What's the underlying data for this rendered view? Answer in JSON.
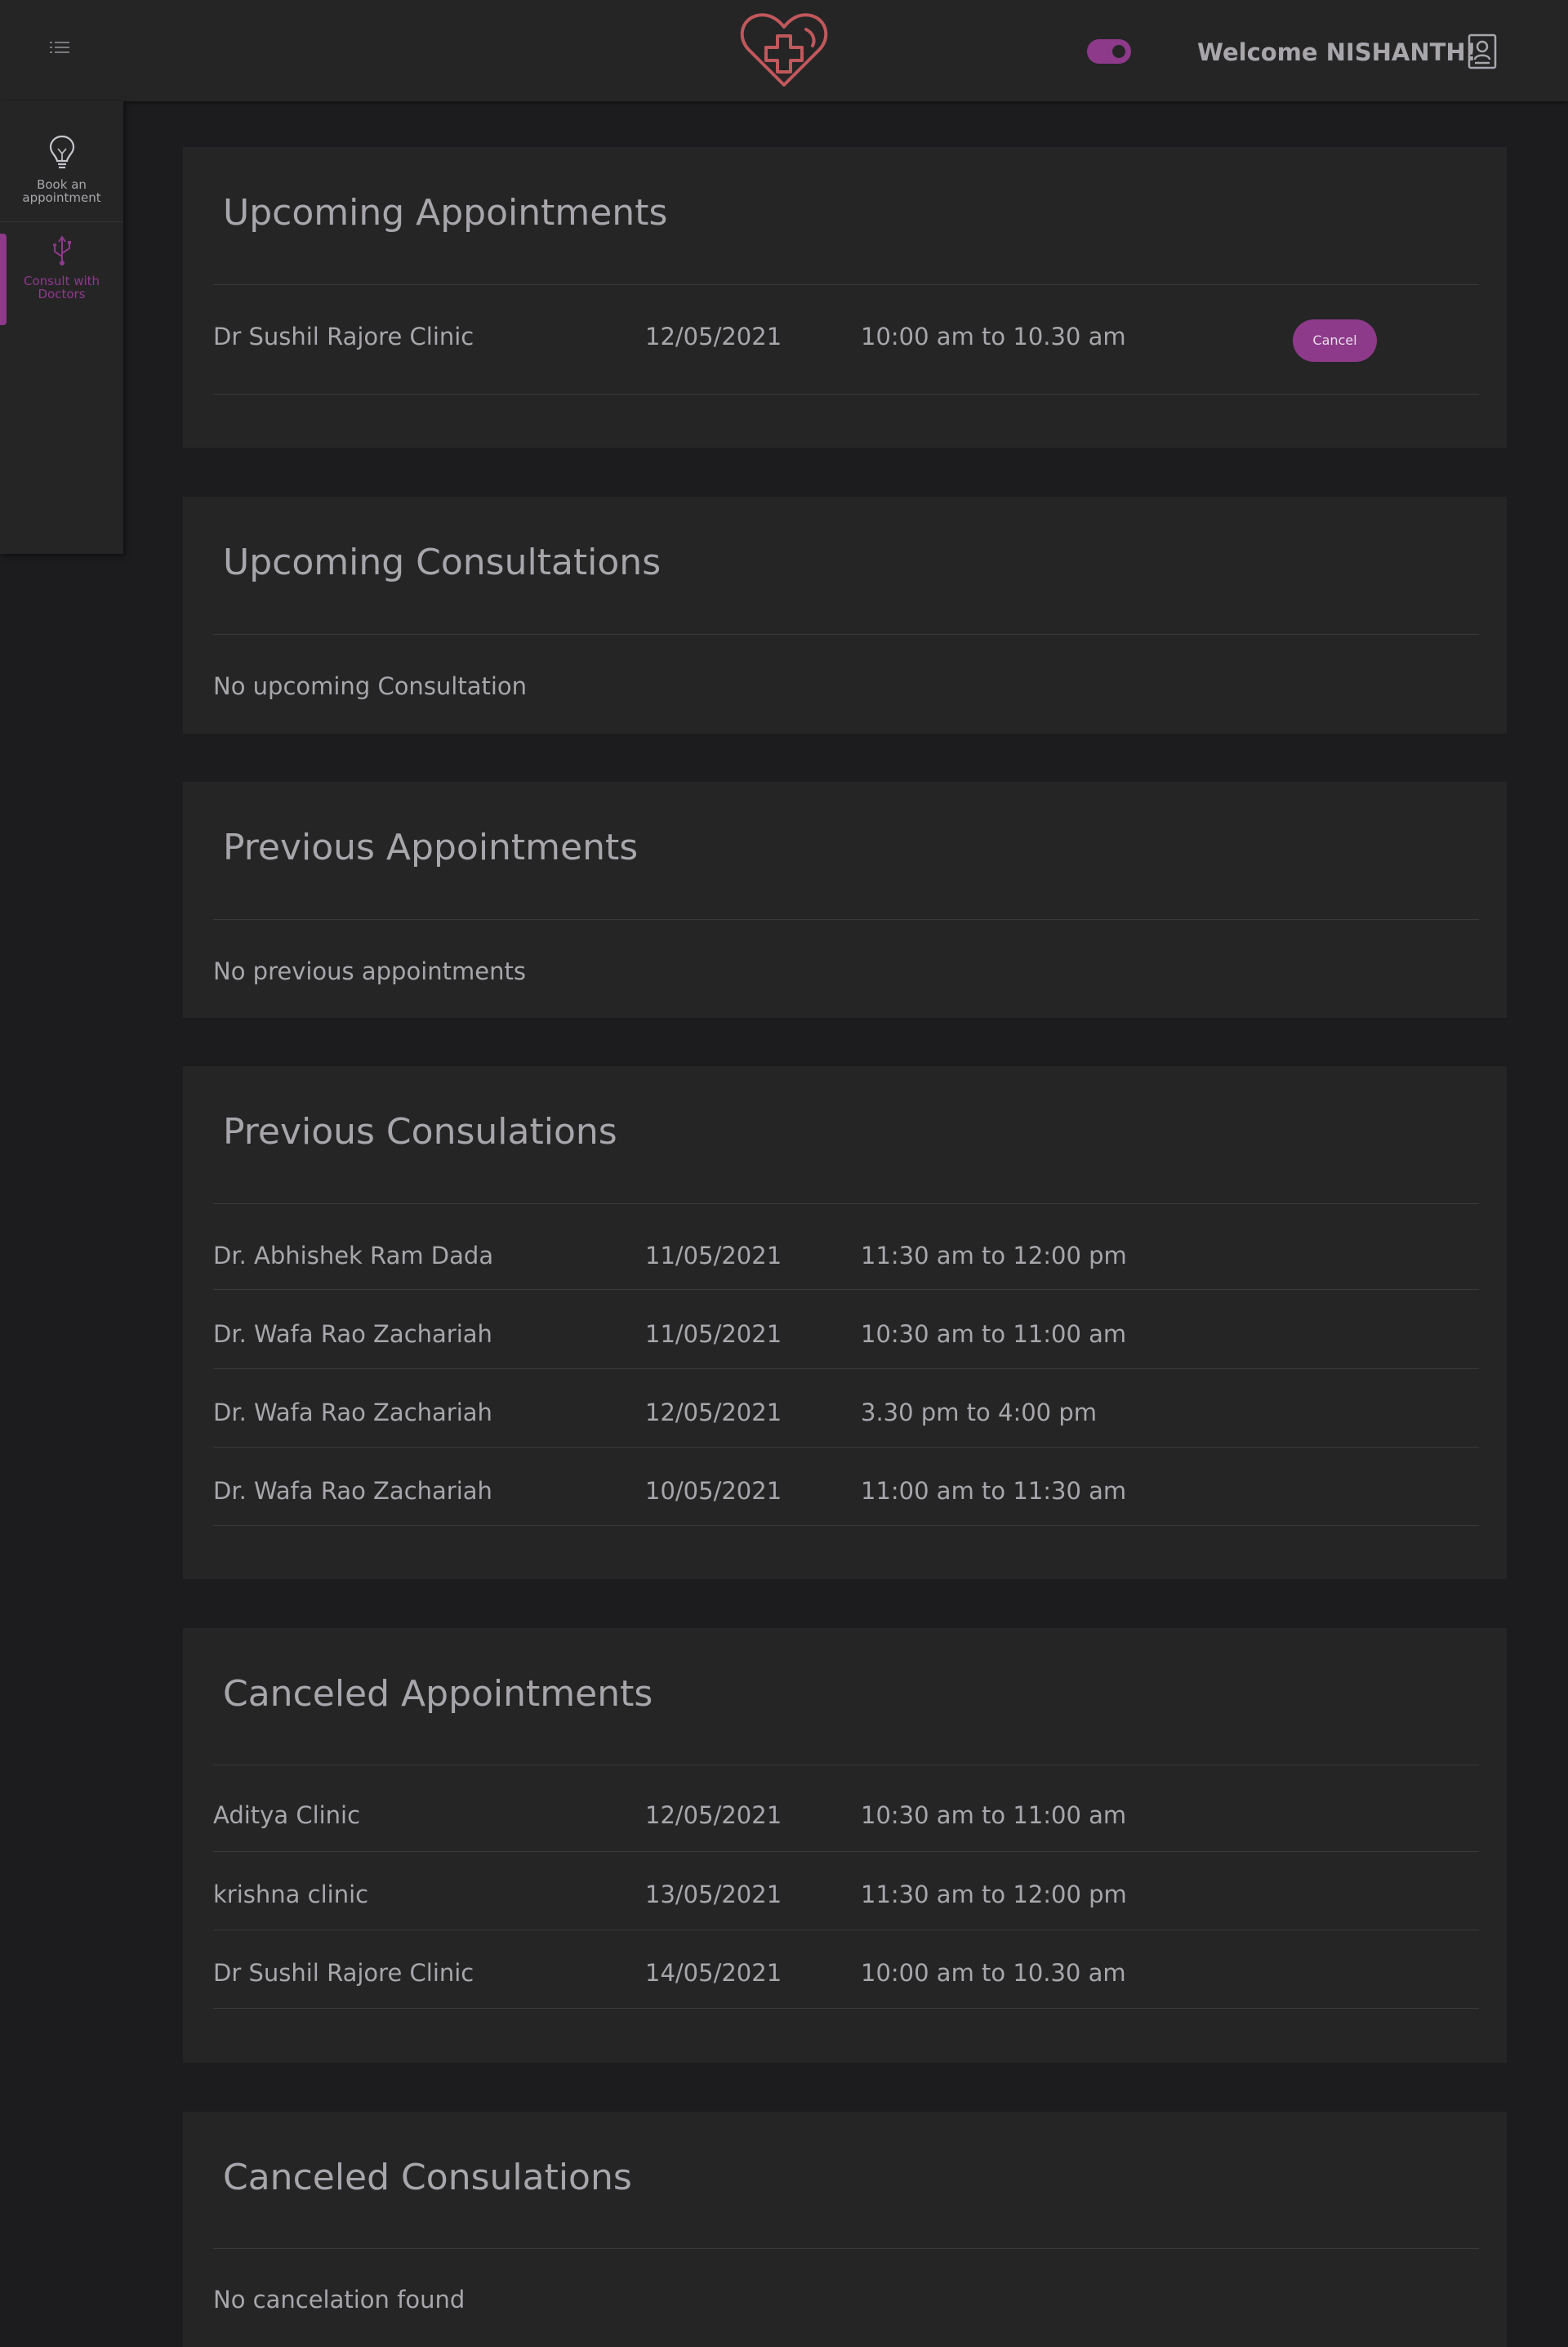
{
  "header": {
    "welcome_text": "Welcome NISHANTH!",
    "theme_toggle_on": true,
    "icons": {
      "menu": "menu-list-icon",
      "logo": "heart-plus-logo",
      "user": "user-profile-icon"
    },
    "colors": {
      "accent": "#8d3a8a",
      "logo": "#c0585c",
      "background": "#252526"
    }
  },
  "sidebar": {
    "items": [
      {
        "label": "Book an appointment",
        "icon": "lightbulb-icon",
        "active": false
      },
      {
        "label": "Consult with Doctors",
        "icon": "usb-icon",
        "active": true
      }
    ]
  },
  "sections": {
    "upcoming_appointments": {
      "title": "Upcoming Appointments",
      "rows": [
        {
          "name": "Dr Sushil Rajore Clinic",
          "date": "12/05/2021",
          "time": "10:00 am to 10.30 am",
          "action": "Cancel"
        }
      ]
    },
    "upcoming_consultations": {
      "title": "Upcoming Consultations",
      "empty_text": "No upcoming Consultation"
    },
    "previous_appointments": {
      "title": "Previous Appointments",
      "empty_text": "No previous appointments"
    },
    "previous_consultations": {
      "title": "Previous Consulations",
      "rows": [
        {
          "name": "Dr. Abhishek Ram Dada",
          "date": "11/05/2021",
          "time": "11:30 am to 12:00 pm"
        },
        {
          "name": "Dr. Wafa Rao Zachariah",
          "date": "11/05/2021",
          "time": "10:30 am to 11:00 am"
        },
        {
          "name": "Dr. Wafa Rao Zachariah",
          "date": "12/05/2021",
          "time": "3.30 pm to 4:00 pm"
        },
        {
          "name": "Dr. Wafa Rao Zachariah",
          "date": "10/05/2021",
          "time": "11:00 am to 11:30 am"
        }
      ]
    },
    "canceled_appointments": {
      "title": "Canceled Appointments",
      "rows": [
        {
          "name": "Aditya Clinic",
          "date": "12/05/2021",
          "time": "10:30 am to 11:00 am"
        },
        {
          "name": "krishna clinic",
          "date": "13/05/2021",
          "time": "11:30 am to 12:00 pm"
        },
        {
          "name": "Dr Sushil Rajore Clinic",
          "date": "14/05/2021",
          "time": "10:00 am to 10.30 am"
        }
      ]
    },
    "canceled_consultations": {
      "title": "Canceled Consulations",
      "empty_text": "No cancelation found"
    }
  }
}
